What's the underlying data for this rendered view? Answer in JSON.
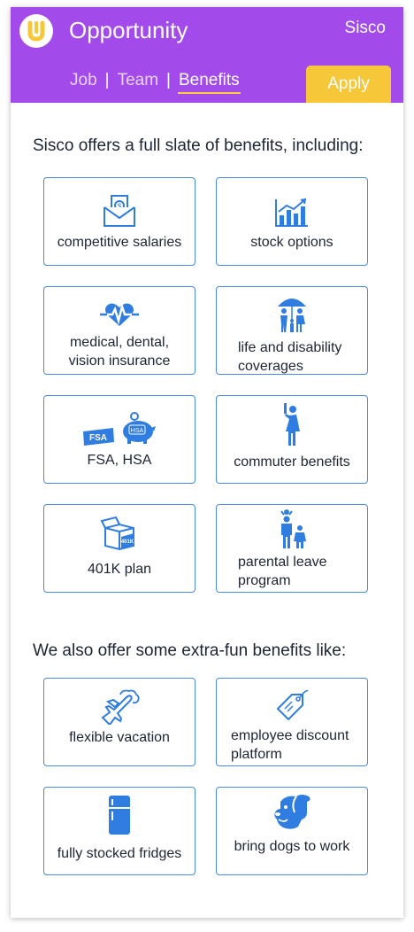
{
  "header": {
    "title": "Opportunity",
    "company": "Sisco",
    "tabs": [
      {
        "label": "Job"
      },
      {
        "label": "Team"
      },
      {
        "label": "Benefits"
      }
    ],
    "separator": "|",
    "apply_label": "Apply"
  },
  "colors": {
    "header_bg": "#a34bea",
    "accent_yellow": "#f6c739",
    "tile_border": "#4a8ae0",
    "icon_blue": "#2f7de0"
  },
  "standard": {
    "heading": "Sisco offers a full slate of benefits, including:",
    "items": [
      {
        "icon": "money-envelope-icon",
        "label": "competitive salaries"
      },
      {
        "icon": "bar-chart-icon",
        "label": "stock options"
      },
      {
        "icon": "heart-pulse-icon",
        "label": "medical, dental, vision insurance"
      },
      {
        "icon": "family-umbrella-icon",
        "label": "life and disability coverages"
      },
      {
        "icon": "fsa-hsa-icon",
        "label": "FSA, HSA"
      },
      {
        "icon": "commuter-icon",
        "label": "commuter benefits"
      },
      {
        "icon": "401k-box-icon",
        "label": "401K plan"
      },
      {
        "icon": "parent-child-icon",
        "label": "parental leave program"
      }
    ]
  },
  "extra": {
    "heading": "We also offer some extra-fun benefits like:",
    "items": [
      {
        "icon": "airplane-icon",
        "label": "flexible vacation"
      },
      {
        "icon": "price-tag-icon",
        "label": "employee discount platform"
      },
      {
        "icon": "fridge-icon",
        "label": "fully stocked fridges"
      },
      {
        "icon": "dog-icon",
        "label": "bring dogs to work"
      }
    ]
  }
}
